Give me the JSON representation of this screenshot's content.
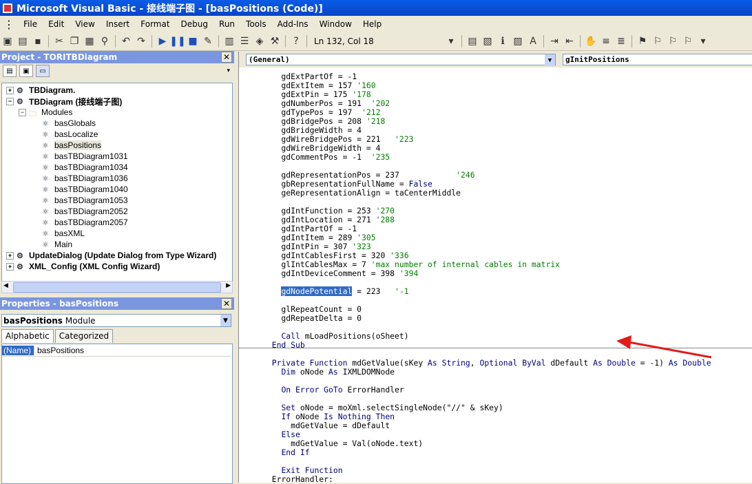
{
  "window": {
    "title": "Microsoft Visual Basic - 接线端子图 - [basPositions (Code)]"
  },
  "menu": [
    "File",
    "Edit",
    "View",
    "Insert",
    "Format",
    "Debug",
    "Run",
    "Tools",
    "Add-Ins",
    "Window",
    "Help"
  ],
  "toolbar": {
    "position": "Ln 132, Col 18"
  },
  "project": {
    "title": "Project - TORITBDiagram",
    "nodes": [
      {
        "label": "TBDiagram.",
        "expander": "+",
        "bold": true,
        "icon": "project-icon"
      },
      {
        "label": "TBDiagram (接线端子图)",
        "expander": "−",
        "bold": true,
        "icon": "project-icon"
      },
      {
        "label": "Modules",
        "expander": "−",
        "bold": false,
        "icon": "folder-icon"
      },
      {
        "label": "basGlobals",
        "icon": "module-icon"
      },
      {
        "label": "basLocalize",
        "icon": "module-icon"
      },
      {
        "label": "basPositions",
        "icon": "module-icon",
        "selected": true
      },
      {
        "label": "basTBDiagram1031",
        "icon": "module-icon"
      },
      {
        "label": "basTBDiagram1034",
        "icon": "module-icon"
      },
      {
        "label": "basTBDiagram1036",
        "icon": "module-icon"
      },
      {
        "label": "basTBDiagram1040",
        "icon": "module-icon"
      },
      {
        "label": "basTBDiagram1053",
        "icon": "module-icon"
      },
      {
        "label": "basTBDiagram2052",
        "icon": "module-icon"
      },
      {
        "label": "basTBDiagram2057",
        "icon": "module-icon"
      },
      {
        "label": "basXML",
        "icon": "module-icon"
      },
      {
        "label": "Main",
        "icon": "module-icon"
      },
      {
        "label": "UpdateDialog (Update Dialog from Type Wizard)",
        "expander": "+",
        "bold": true,
        "icon": "project-icon"
      },
      {
        "label": "XML_Config (XML Config Wizard)",
        "expander": "+",
        "bold": true,
        "icon": "project-icon"
      }
    ]
  },
  "properties": {
    "title": "Properties - basPositions",
    "object_name": "basPositions",
    "object_type": "Module",
    "tabs": [
      "Alphabetic",
      "Categorized"
    ],
    "rows": [
      {
        "name": "(Name)",
        "value": "basPositions"
      }
    ]
  },
  "code_window": {
    "object_combo": "(General)",
    "proc_combo": "gInitPositions",
    "lines": [
      [
        {
          "t": "    gdExtPartOf = -1"
        }
      ],
      [
        {
          "t": "    gdExtItem = 157 "
        },
        {
          "t": "'160",
          "c": "cm"
        }
      ],
      [
        {
          "t": "    gdExtPin = 175 "
        },
        {
          "t": "'178",
          "c": "cm"
        }
      ],
      [
        {
          "t": "    gdNumberPos = 191  "
        },
        {
          "t": "'202",
          "c": "cm"
        }
      ],
      [
        {
          "t": "    gdTypePos = 197  "
        },
        {
          "t": "'212",
          "c": "cm"
        }
      ],
      [
        {
          "t": "    gdBridgePos = 208 "
        },
        {
          "t": "'218",
          "c": "cm"
        }
      ],
      [
        {
          "t": "    gdBridgeWidth = 4"
        }
      ],
      [
        {
          "t": "    gdWireBridgePos = 221   "
        },
        {
          "t": "'223",
          "c": "cm"
        }
      ],
      [
        {
          "t": "    gdWireBridgeWidth = 4"
        }
      ],
      [
        {
          "t": "    gdCommentPos = -1  "
        },
        {
          "t": "'235",
          "c": "cm"
        }
      ],
      [
        {
          "t": ""
        }
      ],
      [
        {
          "t": "    gdRepresentationPos = 237            "
        },
        {
          "t": "'246",
          "c": "cm"
        }
      ],
      [
        {
          "t": "    gbRepresentationFullName = "
        },
        {
          "t": "False",
          "c": "kw"
        }
      ],
      [
        {
          "t": "    geRepresentationAlign = taCenterMiddle"
        }
      ],
      [
        {
          "t": ""
        }
      ],
      [
        {
          "t": "    gdIntFunction = 253 "
        },
        {
          "t": "'270",
          "c": "cm"
        }
      ],
      [
        {
          "t": "    gdIntLocation = 271 "
        },
        {
          "t": "'288",
          "c": "cm"
        }
      ],
      [
        {
          "t": "    gdIntPartOf = -1"
        }
      ],
      [
        {
          "t": "    gdIntItem = 289 "
        },
        {
          "t": "'305",
          "c": "cm"
        }
      ],
      [
        {
          "t": "    gdIntPin = 307 "
        },
        {
          "t": "'323",
          "c": "cm"
        }
      ],
      [
        {
          "t": "    gdIntCablesFirst = 320 "
        },
        {
          "t": "'336",
          "c": "cm"
        }
      ],
      [
        {
          "t": "    glIntCablesMax = 7 "
        },
        {
          "t": "'max number of internal cables in matrix",
          "c": "cm"
        }
      ],
      [
        {
          "t": "    gdIntDeviceComment = 398 "
        },
        {
          "t": "'394",
          "c": "cm"
        }
      ],
      [
        {
          "t": ""
        }
      ],
      [
        {
          "t": "    "
        },
        {
          "t": "gdNodePotential",
          "c": "hl"
        },
        {
          "t": " = 223   "
        },
        {
          "t": "'-1",
          "c": "cm"
        }
      ],
      [
        {
          "t": ""
        }
      ],
      [
        {
          "t": "    glRepeatCount = 0"
        }
      ],
      [
        {
          "t": "    gdRepeatDelta = 0"
        }
      ],
      [
        {
          "t": ""
        }
      ],
      [
        {
          "t": "    "
        },
        {
          "t": "Call",
          "c": "kw"
        },
        {
          "t": " mLoadPositions(oSheet)"
        }
      ],
      [
        {
          "t": "  "
        },
        {
          "t": "End Sub",
          "c": "kw"
        }
      ],
      [
        {
          "t": ""
        }
      ],
      [
        {
          "t": "  "
        },
        {
          "t": "Private Function",
          "c": "kw"
        },
        {
          "t": " mdGetValue(sKey "
        },
        {
          "t": "As String",
          "c": "kw"
        },
        {
          "t": ", "
        },
        {
          "t": "Optional ByVal",
          "c": "kw"
        },
        {
          "t": " dDefault "
        },
        {
          "t": "As Double",
          "c": "kw"
        },
        {
          "t": " = -1) "
        },
        {
          "t": "As Double",
          "c": "kw"
        }
      ],
      [
        {
          "t": "    "
        },
        {
          "t": "Dim",
          "c": "kw"
        },
        {
          "t": " oNode "
        },
        {
          "t": "As",
          "c": "kw"
        },
        {
          "t": " IXMLDOMNode"
        }
      ],
      [
        {
          "t": ""
        }
      ],
      [
        {
          "t": "    "
        },
        {
          "t": "On Error GoTo",
          "c": "kw"
        },
        {
          "t": " ErrorHandler"
        }
      ],
      [
        {
          "t": ""
        }
      ],
      [
        {
          "t": "    "
        },
        {
          "t": "Set",
          "c": "kw"
        },
        {
          "t": " oNode = moXml.selectSingleNode(\"//\" & sKey)"
        }
      ],
      [
        {
          "t": "    "
        },
        {
          "t": "If",
          "c": "kw"
        },
        {
          "t": " oNode "
        },
        {
          "t": "Is Nothing Then",
          "c": "kw"
        }
      ],
      [
        {
          "t": "      mdGetValue = dDefault"
        }
      ],
      [
        {
          "t": "    "
        },
        {
          "t": "Else",
          "c": "kw"
        }
      ],
      [
        {
          "t": "      mdGetValue = Val(oNode.text)"
        }
      ],
      [
        {
          "t": "    "
        },
        {
          "t": "End If",
          "c": "kw"
        }
      ],
      [
        {
          "t": ""
        }
      ],
      [
        {
          "t": "    "
        },
        {
          "t": "Exit Function",
          "c": "kw"
        }
      ],
      [
        {
          "t": "  ErrorHandler:"
        }
      ]
    ]
  }
}
